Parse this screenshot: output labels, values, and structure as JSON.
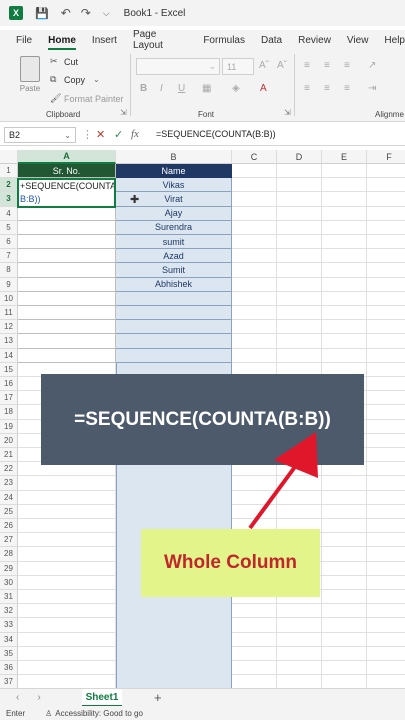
{
  "titlebar": {
    "app_icon": "X",
    "title": "Book1 - Excel"
  },
  "tabs": [
    "File",
    "Home",
    "Insert",
    "Page Layout",
    "Formulas",
    "Data",
    "Review",
    "View",
    "Help"
  ],
  "ribbon": {
    "paste": "Paste",
    "cut": "Cut",
    "copy": "Copy",
    "format_painter": "Format Painter",
    "clipboard_label": "Clipboard",
    "font_size": "11",
    "font_label": "Font",
    "alignment_label": "Alignme",
    "bold": "B",
    "italic": "I",
    "underline": "U"
  },
  "formula_bar": {
    "name_box": "B2",
    "fx": "fx",
    "formula": "=SEQUENCE(COUNTA(B:B))"
  },
  "columns": [
    "A",
    "B",
    "C",
    "D",
    "E",
    "F"
  ],
  "rows": [
    "1",
    "2",
    "3",
    "4",
    "5",
    "6",
    "7",
    "8",
    "9",
    "10",
    "11",
    "12",
    "13",
    "14",
    "15",
    "16",
    "17",
    "18",
    "19",
    "20",
    "21",
    "22",
    "23",
    "24",
    "25",
    "26",
    "27",
    "28",
    "29",
    "30",
    "31",
    "32",
    "33",
    "34",
    "35",
    "36",
    "37",
    "38"
  ],
  "table": {
    "header_a": "Sr. No.",
    "header_b": "Name",
    "names": [
      "Vikas",
      "Virat",
      "Ajay",
      "Surendra",
      "sumit",
      "Azad",
      "Sumit",
      "Abhishek"
    ],
    "active_cell_line1": "+SEQUENCE(COUNTA(",
    "active_cell_line2": "B:B))"
  },
  "overlay": {
    "banner": "=SEQUENCE(COUNTA(B:B))",
    "callout": "Whole Column"
  },
  "sheet_tab": "Sheet1",
  "status": {
    "mode": "Enter",
    "accessibility": "Accessibility: Good to go"
  },
  "colors": {
    "excel_green": "#107c41",
    "header_navy": "#203864",
    "banner": "#4d5a6b",
    "callout_bg": "#e3f58a",
    "callout_text": "#c0262c",
    "arrow": "#e0162b"
  }
}
